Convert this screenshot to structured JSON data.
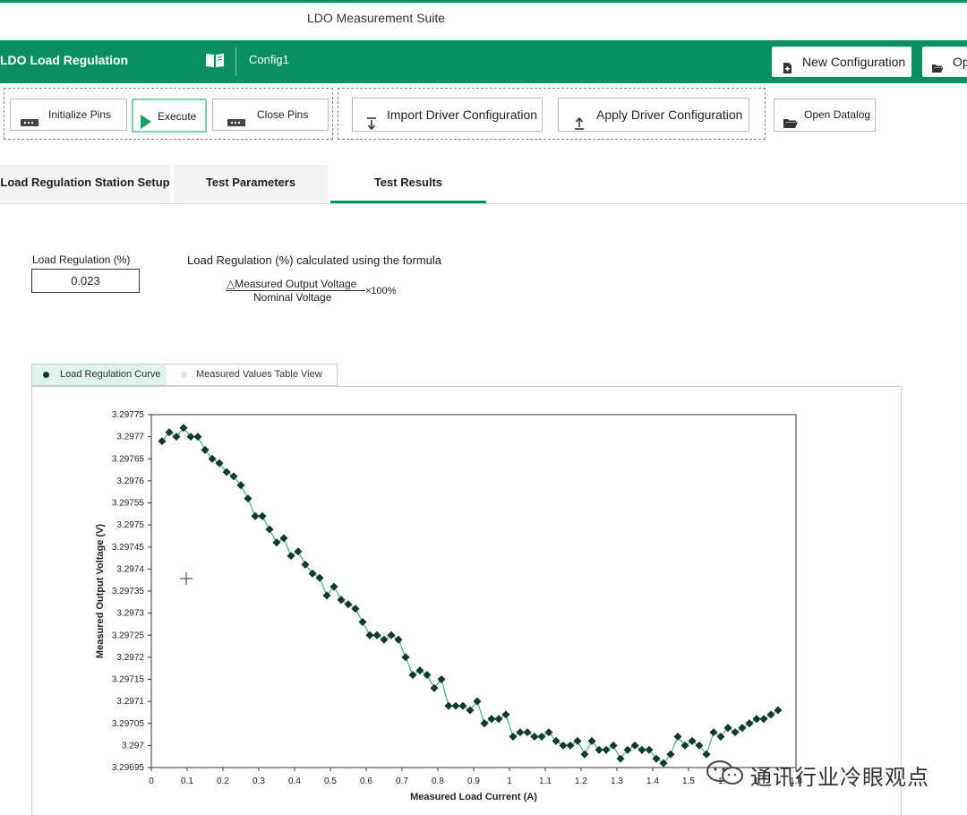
{
  "app": {
    "title": "LDO Measurement Suite"
  },
  "header": {
    "title": "LDO Load Regulation",
    "config_name": "Config1",
    "new_config_label": "New Configuration",
    "open_label": "Op"
  },
  "toolbar": {
    "initialize_pins": "Initialize Pins",
    "execute": "Execute",
    "close_pins": "Close Pins",
    "import_driver": "Import Driver Configuration",
    "apply_driver": "Apply Driver Configuration",
    "open_datalog": "Open Datalog"
  },
  "tabs": [
    {
      "label": "Load Regulation Station Setup"
    },
    {
      "label": "Test Parameters"
    },
    {
      "label": "Test Results",
      "active": true
    }
  ],
  "results": {
    "load_regulation_label": "Load Regulation (%)",
    "load_regulation_value": "0.023",
    "formula_intro": "Load Regulation (%) calculated using the formula",
    "formula_numerator": "△Measured Output Voltage",
    "formula_denominator": "Nominal Voltage",
    "formula_multiplier": "×100%"
  },
  "view_tabs": [
    {
      "label": "Load Regulation Curve",
      "active": true
    },
    {
      "label": "Measured Values Table View",
      "active": false
    }
  ],
  "colors": {
    "brand": "#0a8f61",
    "line": "#3fae8f",
    "marker": "#0e3b2c"
  },
  "chart_data": {
    "type": "line",
    "xlabel": "Measured Load Current (A)",
    "ylabel": "Measured Output Voltage (V)",
    "xlim": [
      0,
      1.8
    ],
    "ylim": [
      3.29695,
      3.29775
    ],
    "x_ticks": [
      "0",
      "0.1",
      "0.2",
      "0.3",
      "0.4",
      "0.5",
      "0.6",
      "0.7",
      "0.8",
      "0.9",
      "1",
      "1.1",
      "1.2",
      "1.3",
      "1.4",
      "1.5",
      "1.6",
      "1.7",
      "1.8"
    ],
    "y_ticks": [
      "3.29695",
      "3.297",
      "3.29705",
      "3.2971",
      "3.29715",
      "3.2972",
      "3.29725",
      "3.2973",
      "3.29735",
      "3.2974",
      "3.29745",
      "3.2975",
      "3.29755",
      "3.2976",
      "3.29765",
      "3.2977",
      "3.29775"
    ],
    "grid": false,
    "series": [
      {
        "x": [
          0.03,
          0.05,
          0.07,
          0.09,
          0.11,
          0.13,
          0.15,
          0.17,
          0.19,
          0.21,
          0.23,
          0.25,
          0.27,
          0.29,
          0.31,
          0.33,
          0.35,
          0.37,
          0.39,
          0.41,
          0.43,
          0.45,
          0.47,
          0.49,
          0.51,
          0.53,
          0.55,
          0.57,
          0.59,
          0.61,
          0.63,
          0.65,
          0.67,
          0.69,
          0.71,
          0.73,
          0.75,
          0.77,
          0.79,
          0.81,
          0.83,
          0.85,
          0.87,
          0.89,
          0.91,
          0.93,
          0.95,
          0.97,
          0.99,
          1.01,
          1.03,
          1.05,
          1.07,
          1.09,
          1.11,
          1.13,
          1.15,
          1.17,
          1.19,
          1.21,
          1.23,
          1.25,
          1.27,
          1.29,
          1.31,
          1.33,
          1.35,
          1.37,
          1.39,
          1.41,
          1.43,
          1.45,
          1.47,
          1.49,
          1.51,
          1.53,
          1.55,
          1.57,
          1.59,
          1.61,
          1.63,
          1.65,
          1.67,
          1.69,
          1.71,
          1.73,
          1.75
        ],
        "values": [
          3.29769,
          3.29771,
          3.2977,
          3.29772,
          3.2977,
          3.2977,
          3.29767,
          3.29765,
          3.29764,
          3.29762,
          3.29761,
          3.29759,
          3.29756,
          3.29752,
          3.29752,
          3.29749,
          3.29746,
          3.29747,
          3.29743,
          3.29744,
          3.29741,
          3.29739,
          3.29738,
          3.29734,
          3.29736,
          3.29733,
          3.29732,
          3.29731,
          3.29728,
          3.29725,
          3.29725,
          3.29724,
          3.29725,
          3.29724,
          3.2972,
          3.29716,
          3.29717,
          3.29716,
          3.29713,
          3.29715,
          3.29709,
          3.29709,
          3.29709,
          3.29708,
          3.2971,
          3.29705,
          3.29706,
          3.29706,
          3.29707,
          3.29702,
          3.29703,
          3.29703,
          3.29702,
          3.29702,
          3.29703,
          3.29701,
          3.297,
          3.297,
          3.29701,
          3.29698,
          3.29701,
          3.29699,
          3.29699,
          3.297,
          3.29697,
          3.29699,
          3.297,
          3.29699,
          3.29699,
          3.29697,
          3.29696,
          3.29698,
          3.29702,
          3.297,
          3.29701,
          3.297,
          3.29698,
          3.29703,
          3.29702,
          3.29704,
          3.29703,
          3.29704,
          3.29705,
          3.29706,
          3.29706,
          3.29707,
          3.29708
        ]
      }
    ]
  },
  "watermark": "通讯行业冷眼观点"
}
